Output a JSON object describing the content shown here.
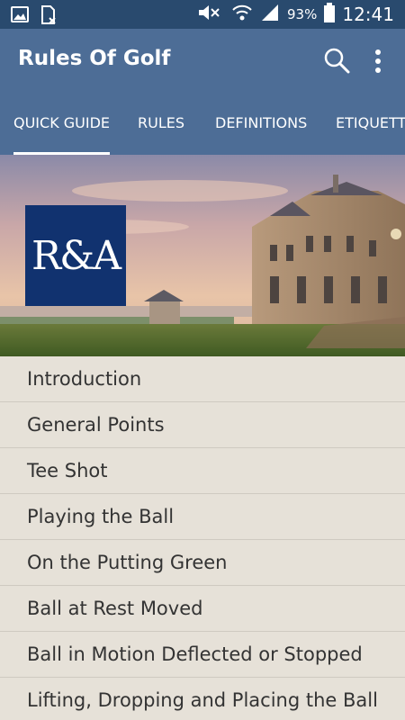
{
  "status_bar": {
    "battery_percent": "93%",
    "time": "12:41",
    "icons": [
      "gallery-icon",
      "sim-blocked-icon",
      "mute-icon",
      "wifi-icon",
      "signal-icon",
      "battery-icon"
    ]
  },
  "app_bar": {
    "title": "Rules Of Golf",
    "icons": [
      "search-icon",
      "more-vert-icon"
    ]
  },
  "tabs": [
    {
      "label": "QUICK GUIDE",
      "active": true
    },
    {
      "label": "RULES",
      "active": false
    },
    {
      "label": "DEFINITIONS",
      "active": false
    },
    {
      "label": "ETIQUETTE",
      "active": false
    }
  ],
  "banner": {
    "logo_text": "R&A"
  },
  "list": [
    "Introduction",
    "General Points",
    "Tee Shot",
    "Playing the Ball",
    "On the Putting Green",
    "Ball at Rest Moved",
    "Ball in Motion Deflected or Stopped",
    "Lifting, Dropping and Placing the Ball"
  ],
  "colors": {
    "status_bar": "#294a6e",
    "app_bar": "#4d6d96",
    "logo_bg": "#11326f",
    "list_bg": "#e6e1d8"
  }
}
